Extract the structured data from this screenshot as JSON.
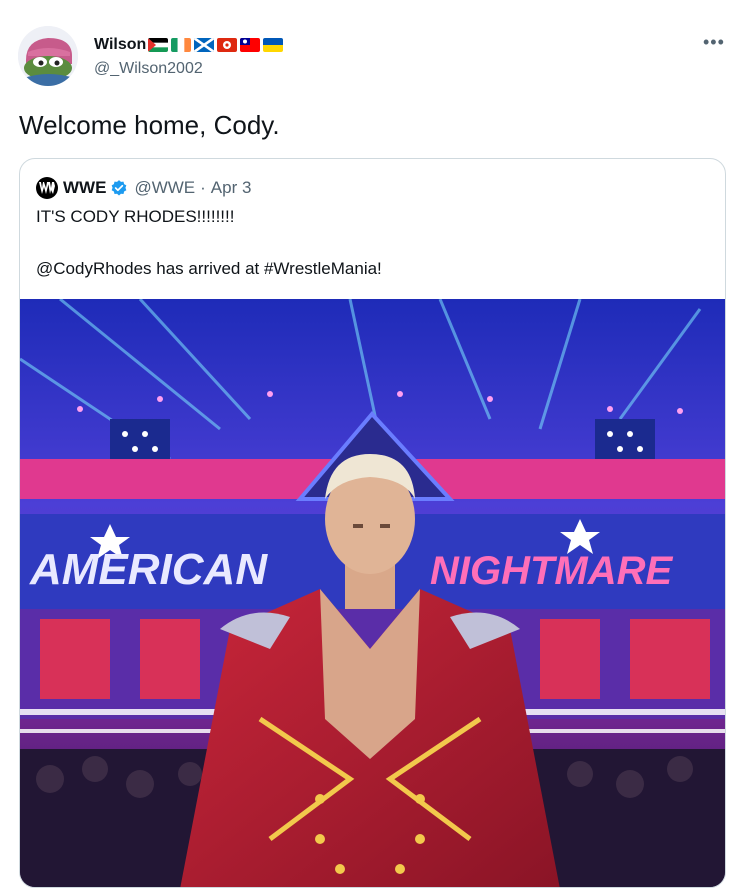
{
  "tweet": {
    "author_name": "Wilson",
    "author_handle": "@_Wilson2002",
    "flags": [
      "flag-palestine-icon",
      "flag-ireland-icon",
      "flag-scotland-icon",
      "flag-hong-kong-icon",
      "flag-taiwan-icon",
      "flag-ukraine-icon"
    ],
    "more_label": "•••",
    "text": "Welcome home, Cody."
  },
  "quote": {
    "name": "WWE",
    "handle": "@WWE",
    "separator": "·",
    "date": "Apr 3",
    "line1": "IT'S CODY RHODES!!!!!!!!",
    "line2": "@CodyRhodes has arrived at #WrestleMania!",
    "media_caption_left": "AMERICAN",
    "media_caption_right": "NIGHTMARE"
  },
  "colors": {
    "text": "#0f1419",
    "secondary": "#536471",
    "border": "#cfd9de",
    "verified": "#1d9bf0"
  }
}
